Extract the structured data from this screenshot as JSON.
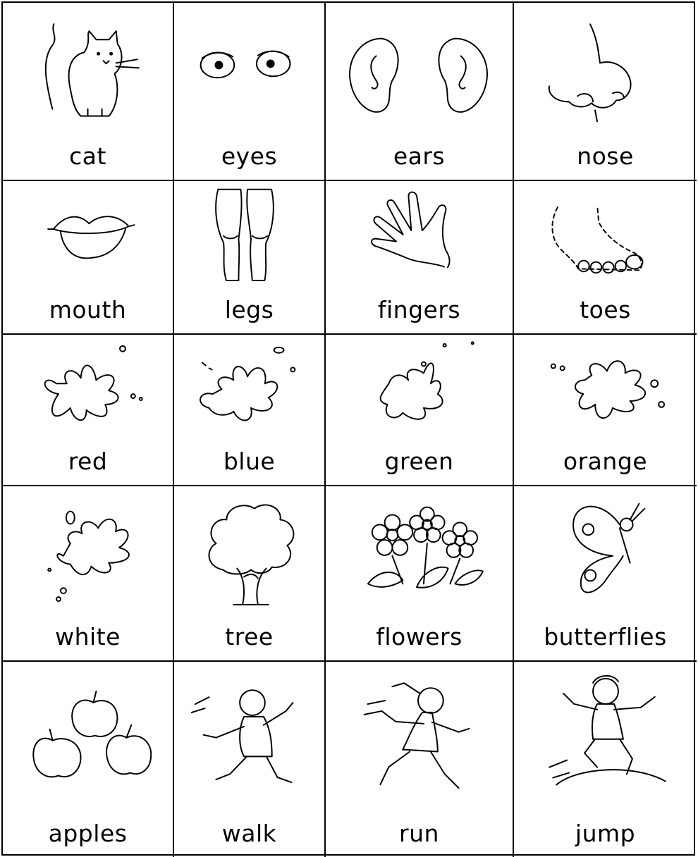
{
  "cards": [
    {
      "word": "cat",
      "icon": "cat-icon"
    },
    {
      "word": "eyes",
      "icon": "eyes-icon"
    },
    {
      "word": "ears",
      "icon": "ears-icon"
    },
    {
      "word": "nose",
      "icon": "nose-icon"
    },
    {
      "word": "mouth",
      "icon": "mouth-icon"
    },
    {
      "word": "legs",
      "icon": "legs-icon"
    },
    {
      "word": "fingers",
      "icon": "hand-icon"
    },
    {
      "word": "toes",
      "icon": "foot-icon"
    },
    {
      "word": "red",
      "icon": "paint-splat-icon"
    },
    {
      "word": "blue",
      "icon": "paint-splat-icon"
    },
    {
      "word": "green",
      "icon": "paint-splat-icon"
    },
    {
      "word": "orange",
      "icon": "paint-splat-icon"
    },
    {
      "word": "white",
      "icon": "paint-splat-icon"
    },
    {
      "word": "tree",
      "icon": "tree-icon"
    },
    {
      "word": "flowers",
      "icon": "flowers-icon"
    },
    {
      "word": "butterflies",
      "icon": "butterfly-icon"
    },
    {
      "word": "apples",
      "icon": "apples-icon"
    },
    {
      "word": "walk",
      "icon": "walking-boy-icon"
    },
    {
      "word": "run",
      "icon": "running-girl-icon"
    },
    {
      "word": "jump",
      "icon": "jumping-boy-icon"
    }
  ]
}
